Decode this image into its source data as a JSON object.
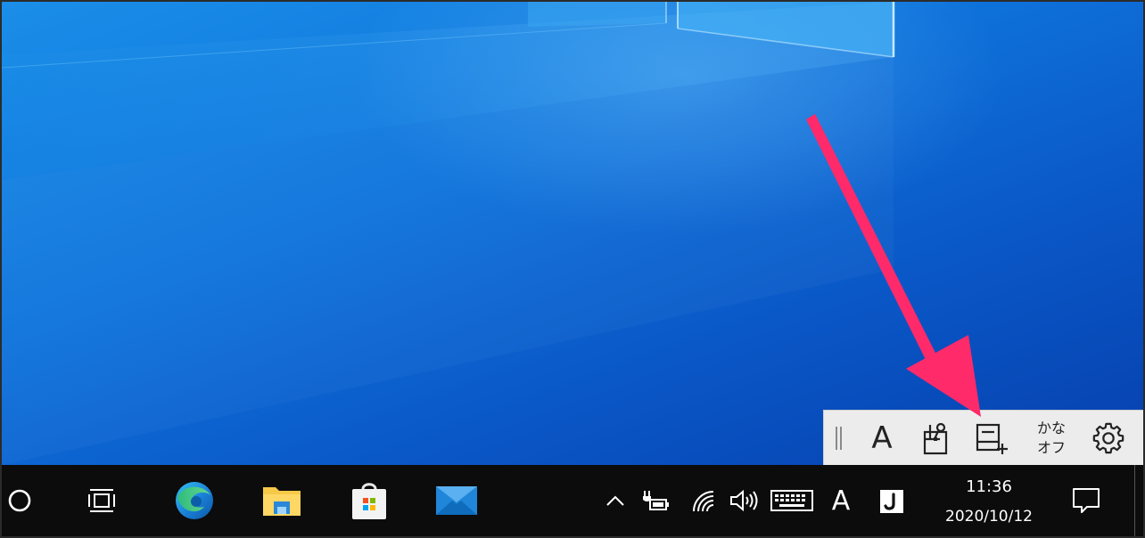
{
  "ime_toolbar": {
    "font_label": "A",
    "kana_line1": "かな",
    "kana_line2": "オフ",
    "icons": [
      "grip-handle-icon",
      "ime-mode-a-icon",
      "ime-pad-icon",
      "word-register-icon",
      "kana-input-toggle",
      "settings-gear-icon"
    ]
  },
  "taskbar": {
    "pinned": [
      "cortana-circle-icon",
      "task-view-icon",
      "edge-icon",
      "file-explorer-icon",
      "microsoft-store-icon",
      "mail-icon"
    ],
    "tray": {
      "icons": [
        "chevron-up-icon",
        "battery-plug-icon",
        "wifi-icon",
        "volume-icon",
        "touch-keyboard-icon",
        "ime-a-icon",
        "ime-j-icon"
      ],
      "ime_label": "A",
      "clock_time": "11:36",
      "clock_date": "2020/10/12"
    }
  },
  "colors": {
    "desktop_blue": "#0f74dc",
    "taskbar": "#0c0c0c",
    "arrow": "#ff2a6a",
    "ime_bar": "#ececec"
  }
}
